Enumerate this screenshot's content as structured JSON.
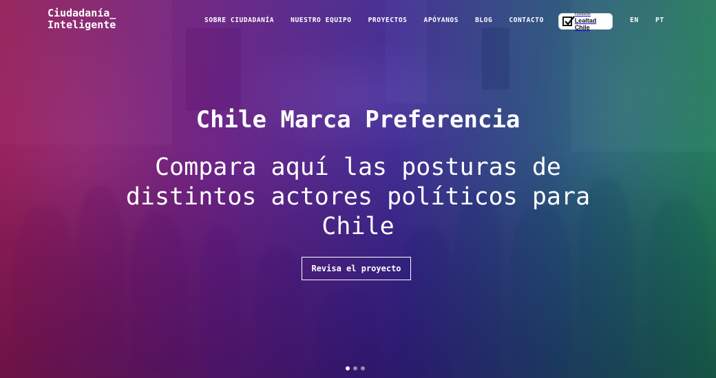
{
  "brand": {
    "logo_line1": "Ciudadanía_",
    "logo_line2": "Inteligente"
  },
  "nav": {
    "items": [
      {
        "label": "SOBRE CIUDADANÍA"
      },
      {
        "label": "NUESTRO EQUIPO"
      },
      {
        "label": "PROYECTOS"
      },
      {
        "label": "APÓYANOS"
      },
      {
        "label": "BLOG"
      },
      {
        "label": "CONTACTO"
      }
    ],
    "badge": {
      "small_text": "Fundación",
      "label": "Lealtad Chile"
    },
    "languages": [
      "EN",
      "PT"
    ]
  },
  "hero": {
    "title": "Chile Marca Preferencia",
    "subtitle": "Compara aquí las posturas de distintos actores políticos para Chile",
    "cta_label": "Revisa el proyecto",
    "slides": {
      "count": 3,
      "active_index": 0
    }
  },
  "colors": {
    "tint_left": "#aa145a",
    "tint_mid": "#3c1eaa",
    "tint_right": "#148c5a",
    "text": "#ffffff"
  }
}
